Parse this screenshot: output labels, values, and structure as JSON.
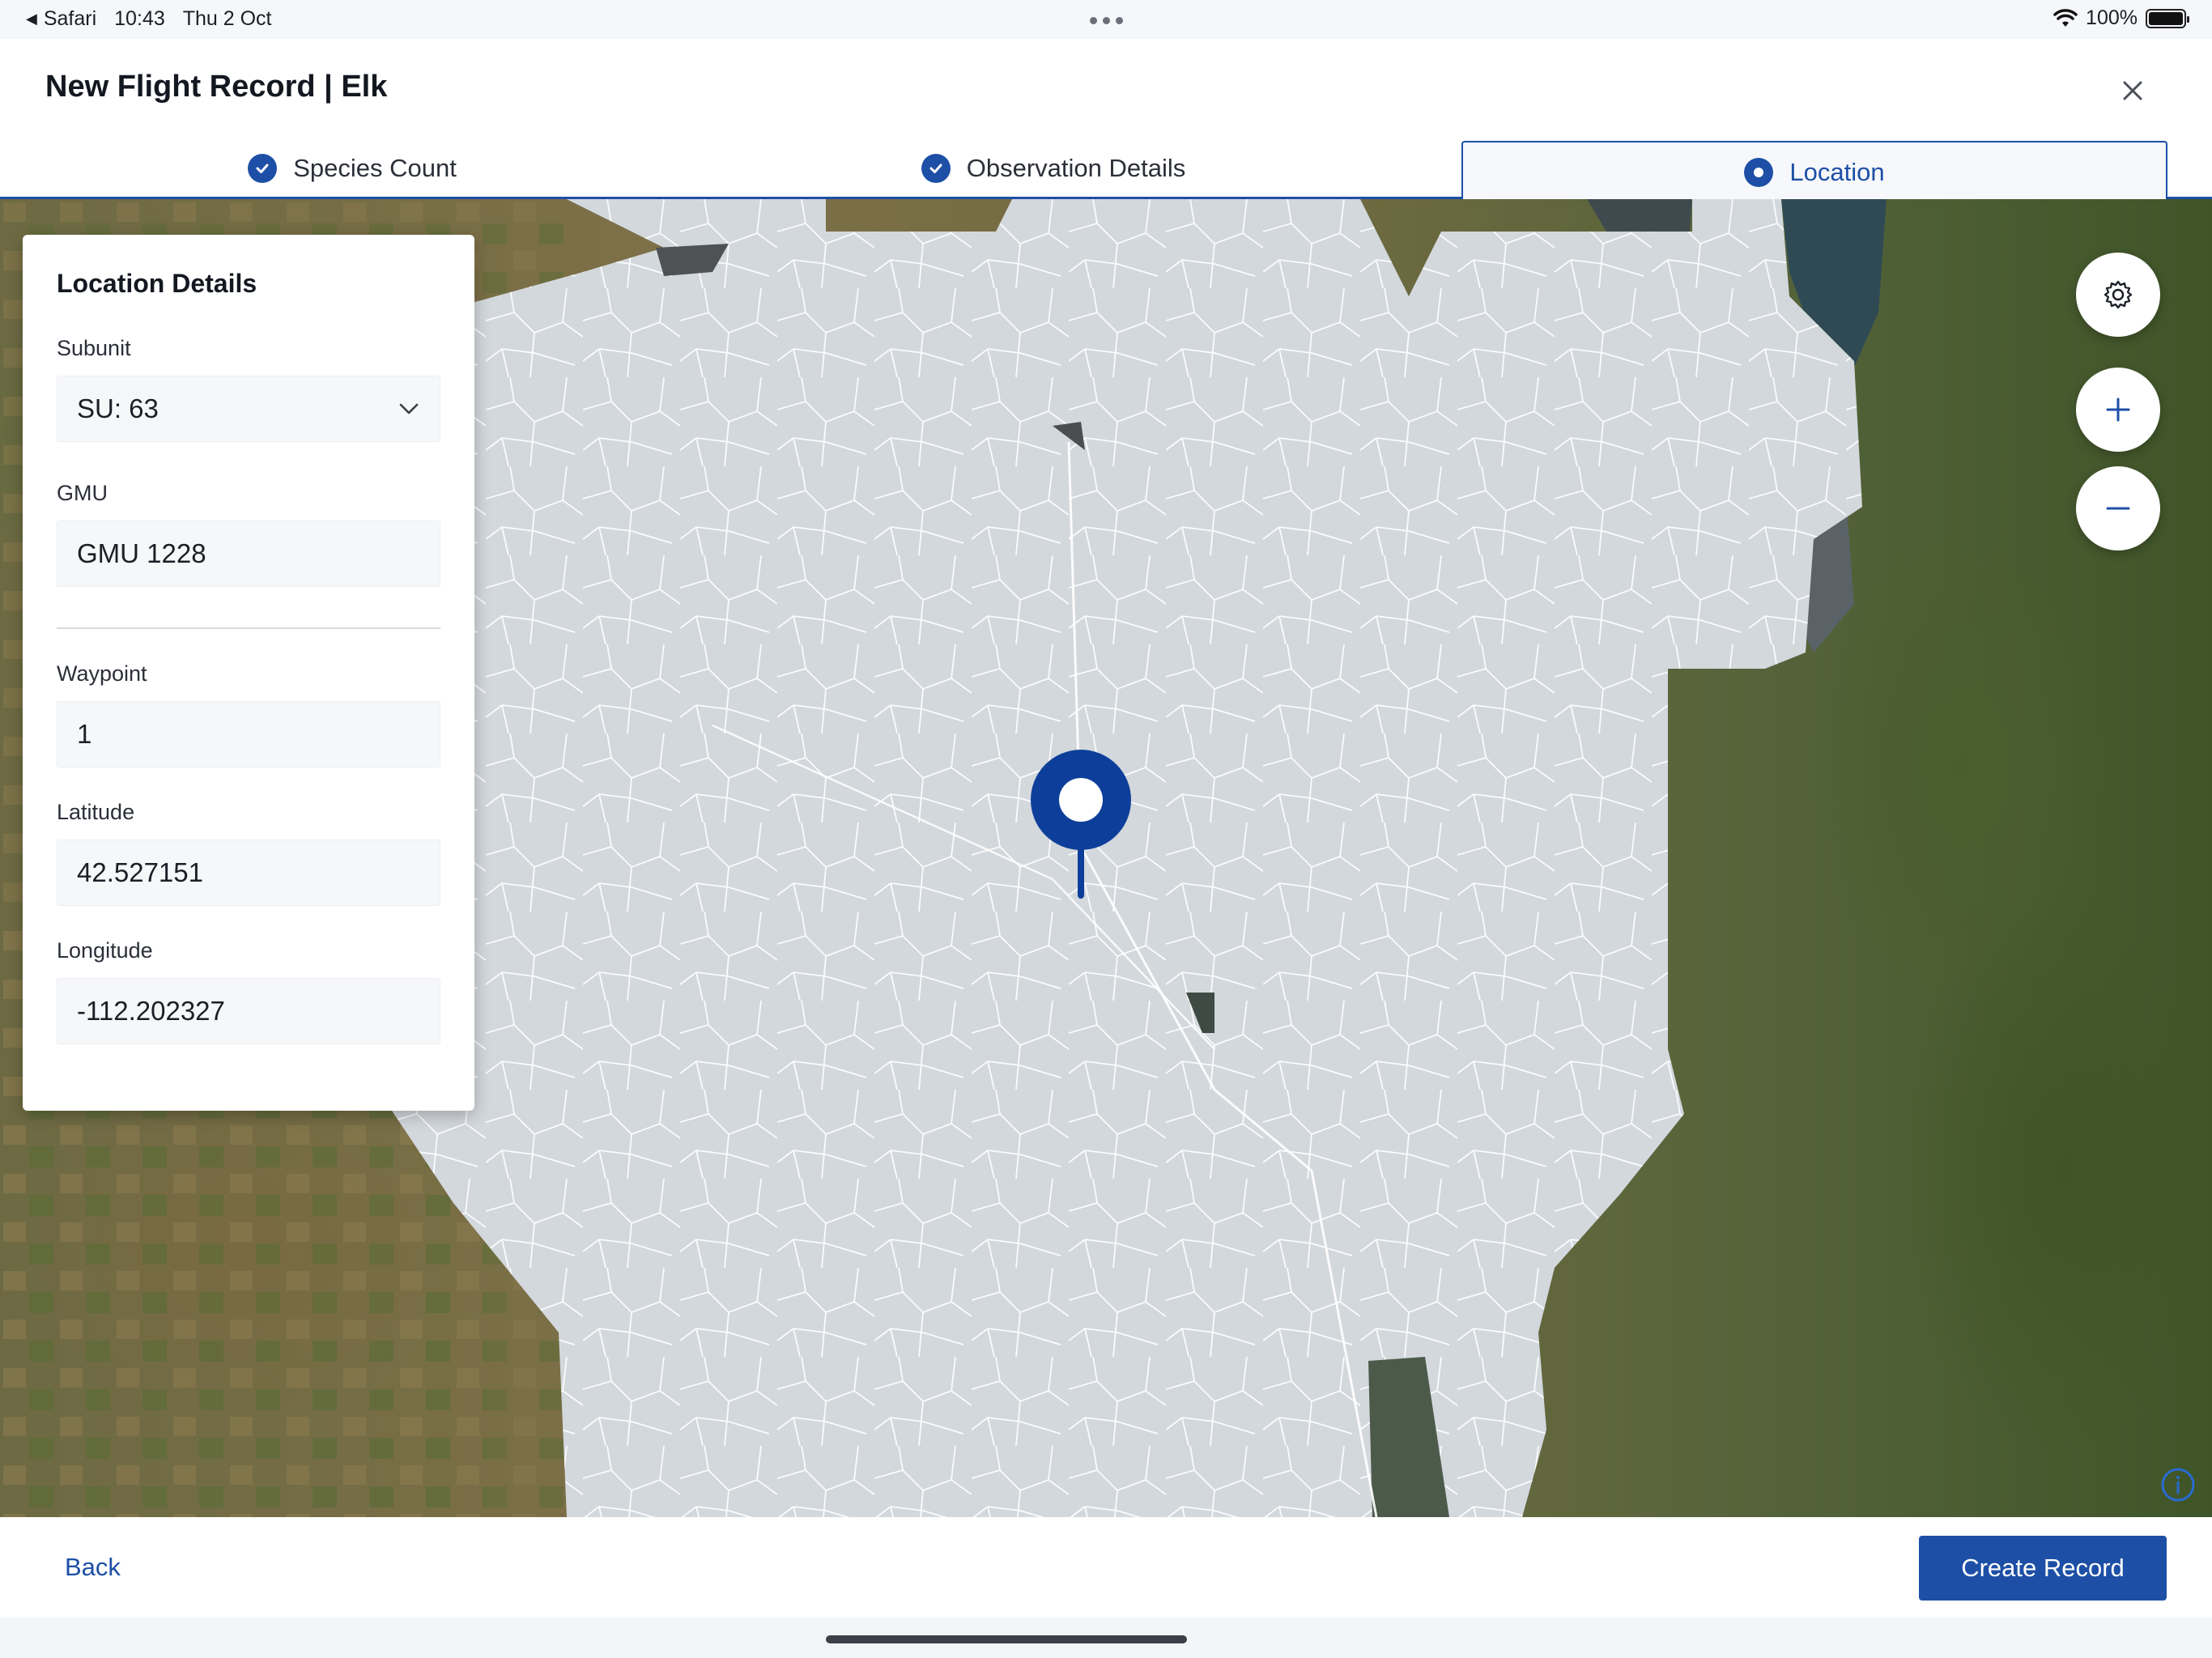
{
  "status_bar": {
    "back_app": "Safari",
    "time": "10:43",
    "date": "Thu 2 Oct",
    "battery": "100%"
  },
  "header": {
    "title": "New Flight Record | Elk"
  },
  "tabs": [
    {
      "label": "Species Count",
      "state": "complete"
    },
    {
      "label": "Observation Details",
      "state": "complete"
    },
    {
      "label": "Location",
      "state": "active"
    }
  ],
  "location_panel": {
    "title": "Location Details",
    "subunit_label": "Subunit",
    "subunit_value": "SU: 63",
    "gmu_label": "GMU",
    "gmu_value": "GMU 1228",
    "waypoint_label": "Waypoint",
    "waypoint_value": "1",
    "latitude_label": "Latitude",
    "latitude_value": "42.527151",
    "longitude_label": "Longitude",
    "longitude_value": "-112.202327"
  },
  "map": {
    "controls": [
      "settings-icon",
      "zoom-in-icon",
      "zoom-out-icon"
    ],
    "marker_color": "#0d3f9a"
  },
  "footer": {
    "back_label": "Back",
    "create_label": "Create Record"
  },
  "colors": {
    "accent": "#1d4fa6"
  }
}
